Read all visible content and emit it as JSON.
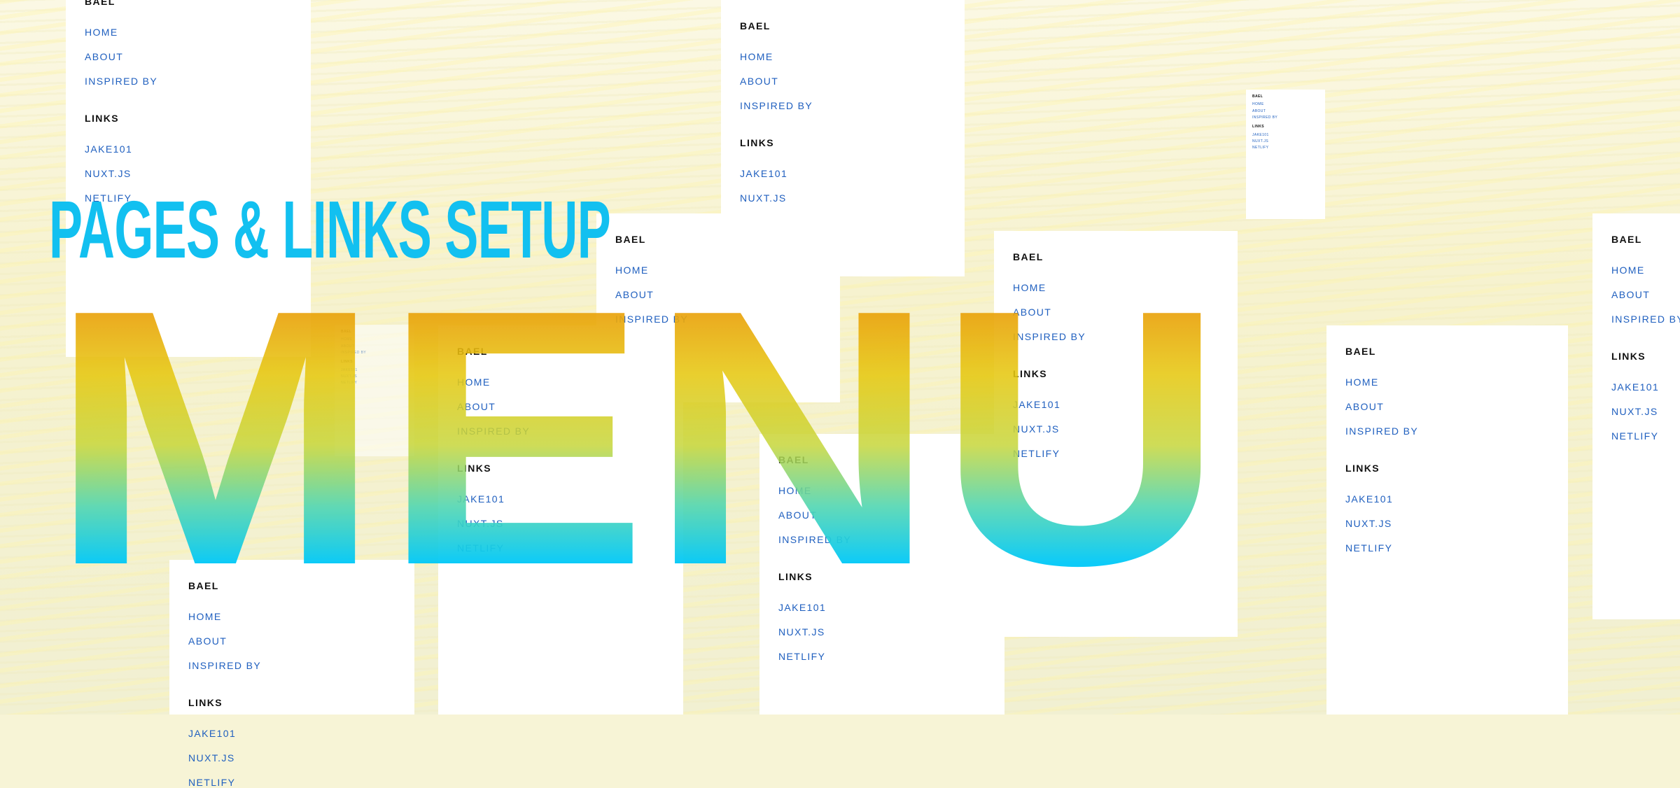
{
  "title": "PAGES & LINKS SETUP",
  "big_word": "MENU",
  "menu_card": {
    "brand": "BAEL",
    "pages": [
      "HOME",
      "ABOUT",
      "INSPIRED BY"
    ],
    "links_heading": "LINKS",
    "links": [
      "JAKE101",
      "NUXT.JS",
      "NETLIFY"
    ]
  },
  "colors": {
    "title": "#12c0f0",
    "gradient_top": "#ea9a08",
    "gradient_mid": "#e6cc12",
    "gradient_low": "#8fd36a",
    "gradient_bottom": "#00c8f8",
    "link": "#1f5fbf",
    "heading": "#111111"
  }
}
